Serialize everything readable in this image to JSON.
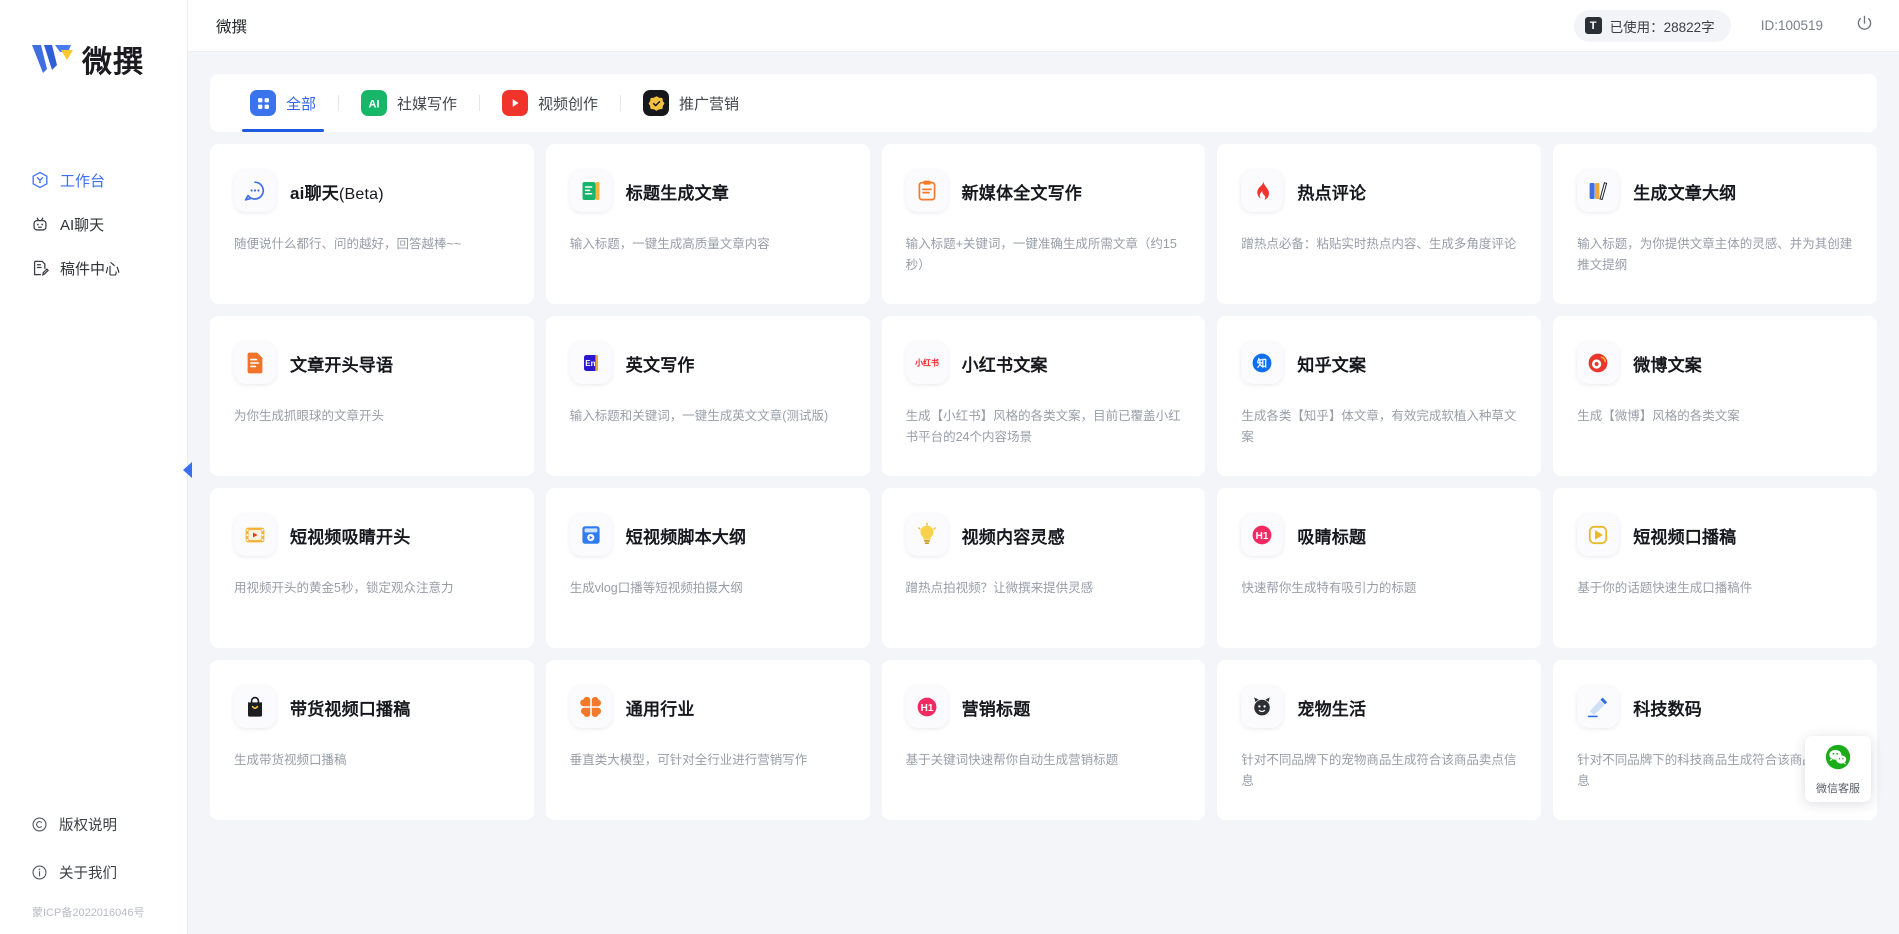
{
  "brand": {
    "name": "微撰",
    "logo_icon": "w-logo-icon"
  },
  "sidebar": {
    "items": [
      {
        "label": "工作台",
        "icon": "workbench-icon",
        "active": true
      },
      {
        "label": "AI聊天",
        "icon": "robot-icon",
        "active": false
      },
      {
        "label": "稿件中心",
        "icon": "document-edit-icon",
        "active": false
      }
    ],
    "bottom_items": [
      {
        "label": "版权说明",
        "icon": "copyright-icon"
      },
      {
        "label": "关于我们",
        "icon": "info-icon"
      }
    ],
    "icp": "蒙ICP备2022016046号",
    "collapse_icon": "collapse-left-icon"
  },
  "topbar": {
    "title": "微撰",
    "usage_label": "已使用：28822字",
    "usage_badge": "T",
    "user_id": "ID:100519",
    "power_icon": "power-icon"
  },
  "tabs": [
    {
      "label": "全部",
      "icon": "grid-icon",
      "active": true
    },
    {
      "label": "社媒写作",
      "icon": "ai-icon",
      "active": false
    },
    {
      "label": "视频创作",
      "icon": "play-icon",
      "active": false
    },
    {
      "label": "推广营销",
      "icon": "badge-check-icon",
      "active": false
    }
  ],
  "cards": [
    {
      "title": "ai聊天",
      "suffix": "(Beta)",
      "desc": "随便说什么都行、问的越好，回答越棒~~",
      "icon": "chat-bubble-icon"
    },
    {
      "title": "标题生成文章",
      "suffix": "",
      "desc": "输入标题，一键生成高质量文章内容",
      "icon": "green-note-icon"
    },
    {
      "title": "新媒体全文写作",
      "suffix": "",
      "desc": "输入标题+关键词，一键准确生成所需文章（约15秒）",
      "icon": "orange-clipboard-icon"
    },
    {
      "title": "热点评论",
      "suffix": "",
      "desc": "蹭热点必备：粘贴实时热点内容、生成多角度评论",
      "icon": "fire-icon"
    },
    {
      "title": "生成文章大纲",
      "suffix": "",
      "desc": "输入标题，为你提供文章主体的灵感、并为其创建推文提纲",
      "icon": "books-icon"
    },
    {
      "title": "文章开头导语",
      "suffix": "",
      "desc": "为你生成抓眼球的文章开头",
      "icon": "orange-doc-icon"
    },
    {
      "title": "英文写作",
      "suffix": "",
      "desc": "输入标题和关键词，一键生成英文文章(测试版)",
      "icon": "en-icon"
    },
    {
      "title": "小红书文案",
      "suffix": "",
      "desc": "生成【小红书】风格的各类文案，目前已覆盖小红书平台的24个内容场景",
      "icon": "xiaohongshu-icon"
    },
    {
      "title": "知乎文案",
      "suffix": "",
      "desc": "生成各类【知乎】体文章，有效完成软植入种草文案",
      "icon": "zhihu-icon"
    },
    {
      "title": "微博文案",
      "suffix": "",
      "desc": "生成【微博】风格的各类文案",
      "icon": "weibo-icon"
    },
    {
      "title": "短视频吸睛开头",
      "suffix": "",
      "desc": "用视频开头的黄金5秒，锁定观众注意力",
      "icon": "film-play-icon"
    },
    {
      "title": "短视频脚本大纲",
      "suffix": "",
      "desc": "生成vlog口播等短视频拍摄大纲",
      "icon": "script-icon"
    },
    {
      "title": "视频内容灵感",
      "suffix": "",
      "desc": "蹭热点拍视频？让微撰来提供灵感",
      "icon": "lightbulb-icon"
    },
    {
      "title": "吸睛标题",
      "suffix": "",
      "desc": "快速帮你生成特有吸引力的标题",
      "icon": "h1-icon"
    },
    {
      "title": "短视频口播稿",
      "suffix": "",
      "desc": "基于你的话题快速生成口播稿件",
      "icon": "yellow-play-icon"
    },
    {
      "title": "带货视频口播稿",
      "suffix": "",
      "desc": "生成带货视频口播稿",
      "icon": "bag-icon"
    },
    {
      "title": "通用行业",
      "suffix": "",
      "desc": "垂直类大模型，可针对全行业进行营销写作",
      "icon": "clover-icon"
    },
    {
      "title": "营销标题",
      "suffix": "",
      "desc": "基于关键词快速帮你自动生成营销标题",
      "icon": "h1-pink-icon"
    },
    {
      "title": "宠物生活",
      "suffix": "",
      "desc": "针对不同品牌下的宠物商品生成符合该商品卖点信息",
      "icon": "pet-icon"
    },
    {
      "title": "科技数码",
      "suffix": "",
      "desc": "针对不同品牌下的科技商品生成符合该商品卖点信息",
      "icon": "tech-icon"
    }
  ],
  "customer_service": {
    "label": "微信客服",
    "icon": "wechat-icon"
  },
  "colors": {
    "accent": "#2f64e8",
    "tab_underline": "#1f5ae0",
    "wechat_green": "#1aad19"
  }
}
